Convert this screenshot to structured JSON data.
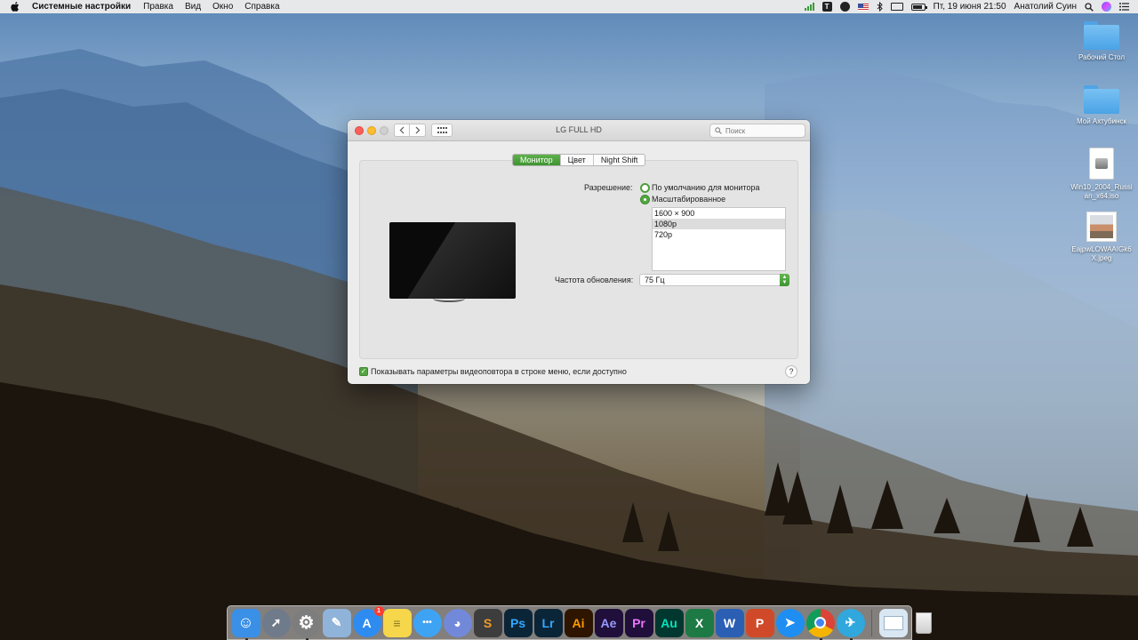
{
  "menubar": {
    "app_name": "Системные настройки",
    "menus": [
      "Правка",
      "Вид",
      "Окно",
      "Справка"
    ],
    "status": {
      "t_icon": "T",
      "datetime": "Пт, 19 июня  21:50",
      "user": "Анатолий Суин"
    },
    "icons": [
      "apple-icon",
      "signal-icon",
      "t-app-icon",
      "telegram-icon",
      "us-flag-icon",
      "bluetooth-icon",
      "airplay-icon",
      "battery-icon",
      "spotlight-icon",
      "siri-icon",
      "notification-center-icon"
    ]
  },
  "desktop": {
    "items": [
      {
        "name": "Рабочий Стол",
        "kind": "folder"
      },
      {
        "name": "Мой Ахтубинск",
        "kind": "folder"
      },
      {
        "name": "Win10_2004_Russian_x64.iso",
        "kind": "iso"
      },
      {
        "name": "EajpwLOWAAIGk6X.jpeg",
        "kind": "image"
      }
    ]
  },
  "window": {
    "title": "LG FULL HD",
    "search_placeholder": "Поиск",
    "tabs": [
      {
        "label": "Монитор",
        "active": true
      },
      {
        "label": "Цвет",
        "active": false
      },
      {
        "label": "Night Shift",
        "active": false
      }
    ],
    "resolution_label": "Разрешение:",
    "resolution_options": [
      {
        "label": "По умолчанию для монитора",
        "selected": false
      },
      {
        "label": "Масштабированное",
        "selected": true
      }
    ],
    "scaled_list": [
      {
        "label": "1600 × 900",
        "selected": false
      },
      {
        "label": "1080p",
        "selected": true
      },
      {
        "label": "720p",
        "selected": false
      }
    ],
    "refresh_label": "Частота обновления:",
    "refresh_value": "75 Гц",
    "mirror_checkbox_label": "Показывать параметры видеоповтора в строке меню, если доступно",
    "mirror_checkbox_checked": true,
    "help_label": "?"
  },
  "dock": {
    "apps": [
      {
        "name": "Finder",
        "icon": "finder-icon",
        "color": "#3a8fe6",
        "glyph": "☺",
        "running": true
      },
      {
        "name": "Launchpad",
        "icon": "rocket-icon",
        "color": "#6f7a8a",
        "glyph": "🚀",
        "running": false
      },
      {
        "name": "Системные настройки",
        "icon": "gear-icon",
        "color": "#7d7d7d",
        "glyph": "⚙",
        "running": true
      },
      {
        "name": "Preview",
        "icon": "preview-icon",
        "color": "#8fb3d9",
        "glyph": "✎",
        "running": false
      },
      {
        "name": "App Store",
        "icon": "app-store-icon",
        "color": "#2e8cf0",
        "glyph": "A",
        "running": false,
        "badge": "1"
      },
      {
        "name": "Notes",
        "icon": "notes-icon",
        "color": "#f6d64a",
        "glyph": "≡",
        "running": false
      },
      {
        "name": "Messages",
        "icon": "messages-icon",
        "color": "#3fa3f3",
        "glyph": "•••",
        "running": false
      },
      {
        "name": "Discord",
        "icon": "discord-icon",
        "color": "#7289da",
        "glyph": "◕",
        "running": false
      },
      {
        "name": "Sublime Text",
        "icon": "sublime-icon",
        "color": "#f29b29",
        "glyph": "S",
        "running": false
      },
      {
        "name": "Photoshop",
        "icon": "photoshop-icon",
        "color": "#0b2538",
        "glyph": "Ps",
        "running": false
      },
      {
        "name": "Lightroom",
        "icon": "lightroom-icon",
        "color": "#0b2538",
        "glyph": "Lr",
        "running": false
      },
      {
        "name": "Illustrator",
        "icon": "illustrator-icon",
        "color": "#2e1500",
        "glyph": "Ai",
        "running": false
      },
      {
        "name": "After Effects",
        "icon": "after-effects-icon",
        "color": "#1f0f3a",
        "glyph": "Ae",
        "running": false
      },
      {
        "name": "Premiere Pro",
        "icon": "premiere-icon",
        "color": "#1f0f3a",
        "glyph": "Pr",
        "running": false
      },
      {
        "name": "Audition",
        "icon": "audition-icon",
        "color": "#003830",
        "glyph": "Au",
        "running": false
      },
      {
        "name": "Excel",
        "icon": "excel-icon",
        "color": "#1d7a45",
        "glyph": "X",
        "running": false
      },
      {
        "name": "Word",
        "icon": "word-icon",
        "color": "#2b5fb4",
        "glyph": "W",
        "running": false
      },
      {
        "name": "PowerPoint",
        "icon": "powerpoint-icon",
        "color": "#d04a2a",
        "glyph": "P",
        "running": false
      },
      {
        "name": "Spark",
        "icon": "spark-icon",
        "color": "#1e8ef2",
        "glyph": "➤",
        "running": false
      },
      {
        "name": "Chrome",
        "icon": "chrome-icon",
        "color": "#e8e8e8",
        "glyph": "◉",
        "running": true
      },
      {
        "name": "Telegram",
        "icon": "telegram-icon",
        "color": "#30a8de",
        "glyph": "✈",
        "running": true
      }
    ],
    "stack": {
      "name": "Downloads",
      "icon": "downloads-stack-icon",
      "color": "#d9e7f2"
    },
    "trash": {
      "name": "Trash",
      "icon": "trash-icon",
      "color": "#e9e9e9"
    },
    "colors": {
      "accent": "#53a641"
    }
  }
}
